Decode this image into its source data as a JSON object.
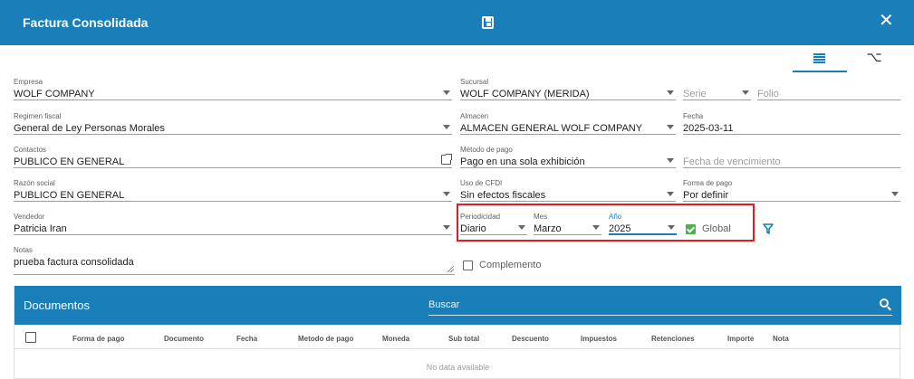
{
  "dialog": {
    "title": "Factura Consolidada"
  },
  "form": {
    "empresa": {
      "label": "Empresa",
      "value": "WOLF COMPANY"
    },
    "sucursal": {
      "label": "Sucursal",
      "value": "WOLF COMPANY (MERIDA)"
    },
    "serie": {
      "placeholder": "Serie"
    },
    "folio": {
      "placeholder": "Folio"
    },
    "regimen": {
      "label": "Regimen fiscal",
      "value": "General de Ley Personas Morales"
    },
    "almacen": {
      "label": "Almacen",
      "value": "ALMACEN GENERAL WOLF COMPANY"
    },
    "fecha": {
      "label": "Fecha",
      "value": "2025-03-11"
    },
    "contactos": {
      "label": "Contactos",
      "value": "PUBLICO EN GENERAL"
    },
    "metodo_pago": {
      "label": "Método de pago",
      "value": "Pago en una sola exhibición"
    },
    "fecha_vencimiento": {
      "placeholder": "Fecha de vencimiento"
    },
    "razon_social": {
      "label": "Razón social",
      "value": "PUBLICO EN GENERAL"
    },
    "uso_cfdi": {
      "label": "Uso de CFDI",
      "value": "Sin efectos fiscales"
    },
    "forma_pago": {
      "label": "Forma de pago",
      "value": "Por definir"
    },
    "vendedor": {
      "label": "Vendedor",
      "value": "Patricia Iran"
    },
    "periodicidad": {
      "label": "Periodicidad",
      "value": "Diario"
    },
    "mes": {
      "label": "Mes",
      "value": "Marzo"
    },
    "anio": {
      "label": "Año",
      "value": "2025"
    },
    "global": {
      "label": "Global",
      "checked": true
    },
    "notas": {
      "label": "Notas",
      "value": "prueba factura consolidada"
    },
    "complemento": {
      "label": "Complemento",
      "checked": false
    }
  },
  "documentos": {
    "title": "Documentos",
    "search_placeholder": "Buscar",
    "columns": [
      "Forma de pago",
      "Documento",
      "Fecha",
      "Metodo de pago",
      "Moneda",
      "Sub total",
      "Descuento",
      "Impuestos",
      "Retenciones",
      "Importe",
      "Nota"
    ],
    "empty_text": "No data available"
  },
  "colors": {
    "primary": "#1a7fb8",
    "highlight": "#e01b2a",
    "check": "#4caf50"
  }
}
